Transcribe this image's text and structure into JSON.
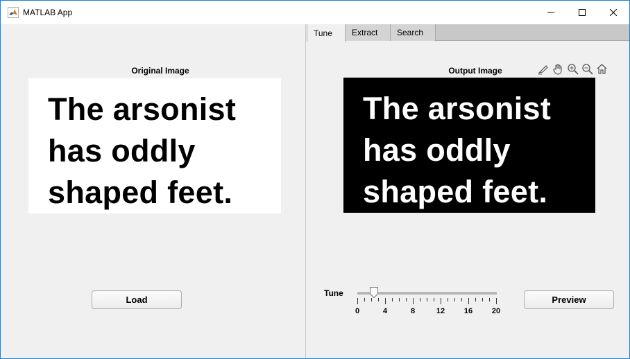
{
  "window": {
    "title": "MATLAB App",
    "minimize_icon": "minimize-icon",
    "maximize_icon": "maximize-icon",
    "close_icon": "close-icon",
    "border_color": "#1883d7"
  },
  "left_panel": {
    "image_title": "Original Image",
    "image_text": [
      "The arsonist",
      "has oddly",
      "shaped feet."
    ],
    "load_label": "Load"
  },
  "right_panel": {
    "tabs": [
      {
        "label": "Tune",
        "active": true
      },
      {
        "label": "Extract",
        "active": false
      },
      {
        "label": "Search",
        "active": false
      }
    ],
    "image_title": "Output Image",
    "image_text": [
      "The arsonist",
      "has oddly",
      "shaped feet."
    ],
    "axes_toolbar": [
      "brush-icon",
      "pan-hand-icon",
      "zoom-in-icon",
      "zoom-out-icon",
      "home-icon"
    ],
    "slider": {
      "label": "Tune",
      "min": 0,
      "max": 20,
      "value": 2.4,
      "major_ticks": [
        0,
        4,
        8,
        12,
        16,
        20
      ],
      "minor_step": 1
    },
    "preview_label": "Preview"
  }
}
